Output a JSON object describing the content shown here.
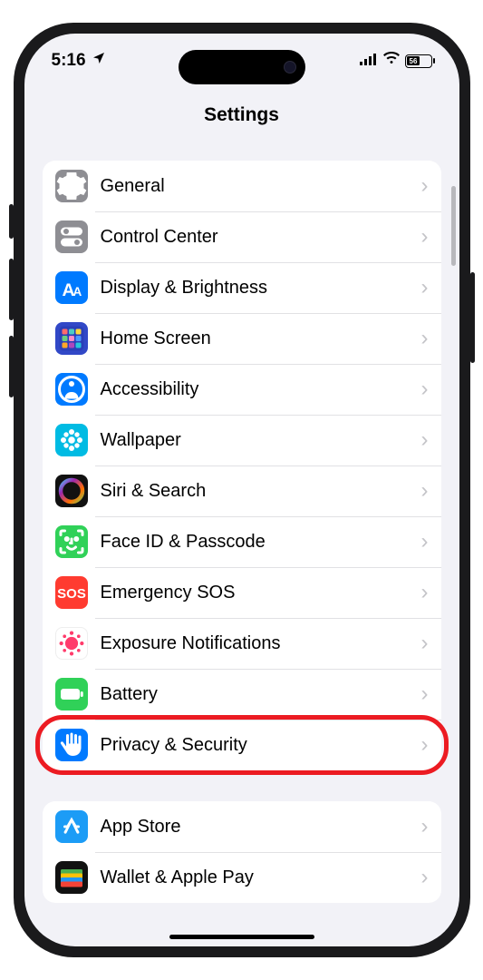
{
  "status": {
    "time": "5:16",
    "battery": "56"
  },
  "header": {
    "title": "Settings"
  },
  "sections": [
    {
      "items": [
        {
          "key": "general",
          "label": "General",
          "icon_bg": "#8e8e93",
          "icon": "gear",
          "highlight": false
        },
        {
          "key": "control-center",
          "label": "Control Center",
          "icon_bg": "#8e8e93",
          "icon": "switches",
          "highlight": false
        },
        {
          "key": "display-brightness",
          "label": "Display & Brightness",
          "icon_bg": "#007aff",
          "icon": "aa",
          "highlight": false
        },
        {
          "key": "home-screen",
          "label": "Home Screen",
          "icon_bg": "#3148c7",
          "icon": "apps-grid",
          "highlight": false
        },
        {
          "key": "accessibility",
          "label": "Accessibility",
          "icon_bg": "#007aff",
          "icon": "person-circle",
          "highlight": false
        },
        {
          "key": "wallpaper",
          "label": "Wallpaper",
          "icon_bg": "#00bbe3",
          "icon": "flower",
          "highlight": false
        },
        {
          "key": "siri-search",
          "label": "Siri & Search",
          "icon_bg": "#111",
          "icon": "siri",
          "highlight": false
        },
        {
          "key": "face-id",
          "label": "Face ID & Passcode",
          "icon_bg": "#30d158",
          "icon": "face",
          "highlight": false
        },
        {
          "key": "emergency-sos",
          "label": "Emergency SOS",
          "icon_bg": "#ff3b30",
          "icon": "sos",
          "highlight": false
        },
        {
          "key": "exposure",
          "label": "Exposure Notifications",
          "icon_bg": "#fff",
          "icon": "covid",
          "highlight": false
        },
        {
          "key": "battery",
          "label": "Battery",
          "icon_bg": "#30d158",
          "icon": "battery",
          "highlight": false
        },
        {
          "key": "privacy-security",
          "label": "Privacy & Security",
          "icon_bg": "#007aff",
          "icon": "hand",
          "highlight": true
        }
      ]
    },
    {
      "items": [
        {
          "key": "app-store",
          "label": "App Store",
          "icon_bg": "#1c9cf6",
          "icon": "appstore",
          "highlight": false
        },
        {
          "key": "wallet",
          "label": "Wallet & Apple Pay",
          "icon_bg": "#111",
          "icon": "wallet",
          "highlight": false
        }
      ]
    }
  ]
}
